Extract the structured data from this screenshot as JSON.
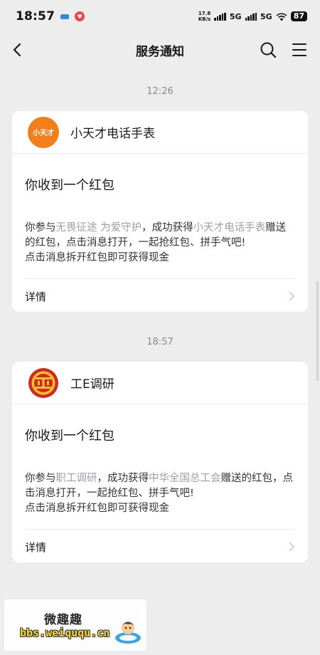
{
  "status_bar": {
    "time": "18:57",
    "net_speed_value": "17.8",
    "net_speed_unit": "KB/s",
    "network_1": "5G",
    "network_2": "5G",
    "battery": "87"
  },
  "nav": {
    "title": "服务通知"
  },
  "messages": [
    {
      "timestamp": "12:26",
      "sender": "小天才电话手表",
      "avatar_text": "小天才",
      "avatar_color": "#f27f1c",
      "title": "你收到一个红包",
      "body_prefix": "你参与",
      "activity": "无畏征途 为爱守护",
      "body_mid": "，成功获得",
      "giver": "小天才电话手表",
      "body_suffix": "赠送的红包，点击消息打开，一起抢红包、拼手气吧!",
      "body_line2": "点击消息拆开红包即可获得现金",
      "details_label": "详情"
    },
    {
      "timestamp": "18:57",
      "sender": "工E调研",
      "avatar_color": "#d02a1f",
      "title": "你收到一个红包",
      "body_prefix": "你参与",
      "activity": "职工调研",
      "body_mid": "，成功获得",
      "giver": "中华全国总工会",
      "body_suffix": "赠送的红包，点击消息打开，一起抢红包、拼手气吧!",
      "body_line2": "点击消息拆开红包即可获得现金",
      "details_label": "详情"
    }
  ],
  "watermark": {
    "title": "微趣趣",
    "url": "bbs.weiququ.cn"
  },
  "colors": {
    "background": "#ededed",
    "card": "#ffffff",
    "link_gray": "#9aa0a8",
    "timestamp": "#8a8a8a"
  }
}
